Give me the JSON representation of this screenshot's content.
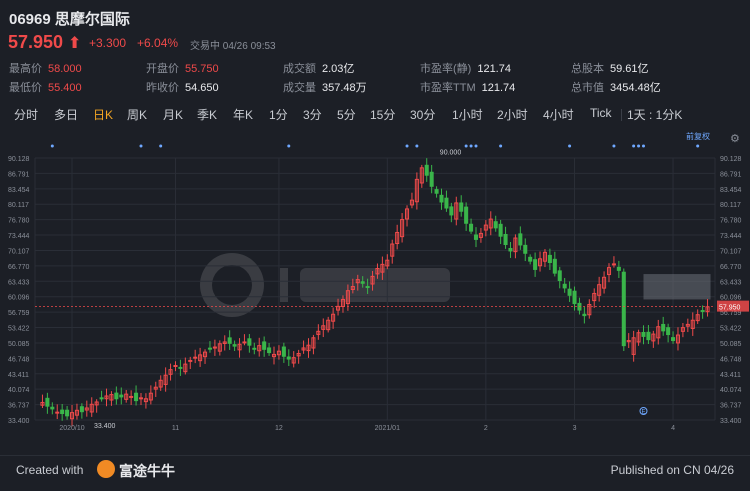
{
  "stock": {
    "title": "06969 思摩尔国际",
    "price": "57.950",
    "arrow": "⬆",
    "change": "+3.300",
    "change_pct": "+6.04%",
    "trade_time": "交易中 04/26 09:53"
  },
  "stats": {
    "high_label": "最高价",
    "high": "58.000",
    "low_label": "最低价",
    "low": "55.400",
    "open_label": "开盘价",
    "open": "55.750",
    "prev_close_label": "昨收价",
    "prev_close": "54.650",
    "turnover_label": "成交额",
    "turnover": "2.03亿",
    "volume_label": "成交量",
    "volume": "357.48万",
    "pe_static_label": "市盈率(静)",
    "pe_static": "121.74",
    "pe_ttm_label": "市盈率TTM",
    "pe_ttm": "121.74",
    "shares_label": "总股本",
    "shares": "59.61亿",
    "mktcap_label": "总市值",
    "mktcap": "3454.48亿"
  },
  "tabs": [
    "分时",
    "多日",
    "日K",
    "周K",
    "月K",
    "季K",
    "年K",
    "1分",
    "3分",
    "5分",
    "15分",
    "30分",
    "1小时",
    "2小时",
    "4小时",
    "Tick",
    "1天 : 1分K"
  ],
  "active_tab": "日K",
  "chart_labels": {
    "before_right": "前复权",
    "max_label": "90.000",
    "min_label": "33.400",
    "current_price": "57.950"
  },
  "chart_data": {
    "type": "candlestick",
    "y_ticks": [
      "90.128",
      "86.791",
      "83.454",
      "80.117",
      "76.780",
      "73.444",
      "70.107",
      "66.770",
      "63.433",
      "60.096",
      "56.759",
      "53.422",
      "50.085",
      "46.748",
      "43.411",
      "40.074",
      "36.737",
      "33.400"
    ],
    "ylim": [
      33.4,
      90.128
    ],
    "x_ticks": [
      "2020/10",
      "11",
      "12",
      "2021/01",
      "2",
      "3",
      "4"
    ],
    "x_tick_index": [
      6,
      27,
      48,
      70,
      90,
      108,
      128
    ],
    "max_point": {
      "label": "90.000",
      "value": 90.0
    },
    "min_point": {
      "label": "33.400",
      "value": 33.4
    },
    "current_price": 57.95,
    "colors": {
      "up": "#ef4a4a",
      "down": "#3ab54a",
      "grid": "#2a2e37",
      "axis_text": "#8a8f99",
      "price_line": "#ef4a4a"
    },
    "closes": [
      37.2,
      36.4,
      35.8,
      35.1,
      34.8,
      34.3,
      35.0,
      35.5,
      35.2,
      36.0,
      36.8,
      37.3,
      38.1,
      38.6,
      38.9,
      38.0,
      38.4,
      39.0,
      38.5,
      37.6,
      38.2,
      38.0,
      39.2,
      40.5,
      42.0,
      43.1,
      44.3,
      45.2,
      44.6,
      45.5,
      46.3,
      47.0,
      47.5,
      48.1,
      48.8,
      49.2,
      49.9,
      50.3,
      50.0,
      49.4,
      49.8,
      50.3,
      49.6,
      48.9,
      49.5,
      48.7,
      48.0,
      47.6,
      48.3,
      47.2,
      46.6,
      46.9,
      47.8,
      49.0,
      49.6,
      51.2,
      52.6,
      53.8,
      55.0,
      56.3,
      58.0,
      59.5,
      61.4,
      62.3,
      63.8,
      63.0,
      62.2,
      64.5,
      66.2,
      67.1,
      68.0,
      71.5,
      74.0,
      76.8,
      79.1,
      81.0,
      85.5,
      88.0,
      86.4,
      84.0,
      82.5,
      80.6,
      79.3,
      77.8,
      80.4,
      78.6,
      76.0,
      74.3,
      72.5,
      73.8,
      75.6,
      76.9,
      75.0,
      73.2,
      71.4,
      70.0,
      72.8,
      71.3,
      69.5,
      67.8,
      66.0,
      68.3,
      69.7,
      67.5,
      65.2,
      63.6,
      62.0,
      60.4,
      58.6,
      57.2,
      56.0,
      58.4,
      60.8,
      62.7,
      64.3,
      66.4,
      67.2,
      65.8,
      49.5,
      50.6,
      51.2,
      52.3,
      51.5,
      50.8,
      52.0,
      53.6,
      52.7,
      51.9,
      50.6,
      51.8,
      53.4,
      54.1,
      55.0,
      56.2,
      57.0,
      57.9
    ],
    "highlight_box": {
      "from_value": 65.0,
      "to_value": 59.5
    }
  },
  "footer": {
    "created_with": "Created with",
    "brand": "富途牛牛",
    "published": "Published on CN 04/26"
  }
}
